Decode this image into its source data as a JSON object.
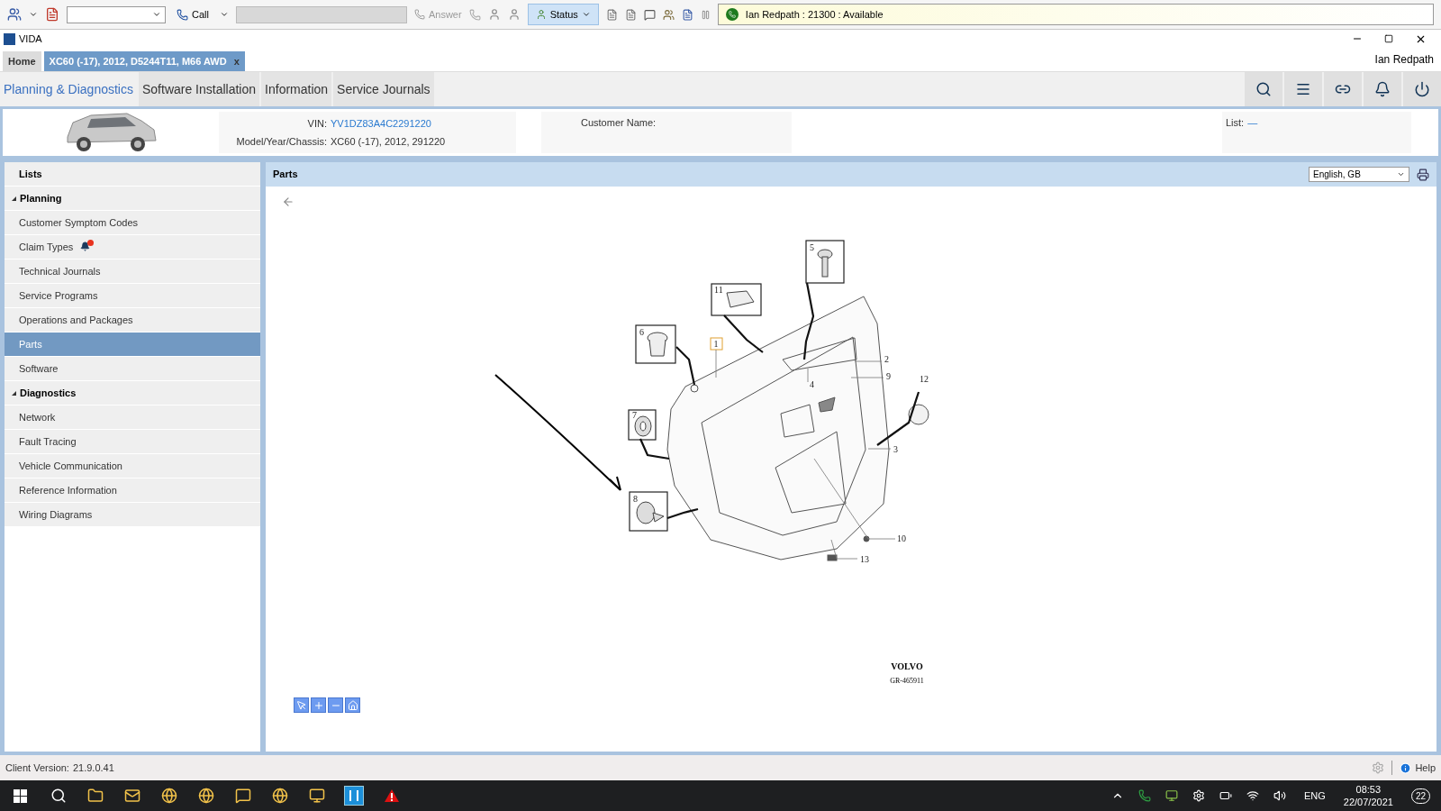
{
  "toolbar": {
    "call": "Call",
    "answer": "Answer",
    "status": "Status",
    "presence": "Ian Redpath : 21300 : Available"
  },
  "window": {
    "title": "VIDA",
    "user": "Ian Redpath"
  },
  "tabs": [
    {
      "label": "Home",
      "selected": false
    },
    {
      "label": "XC60 (-17), 2012, D5244T11, M66 AWD",
      "selected": true,
      "close": "x"
    }
  ],
  "nav": [
    {
      "label": "Planning & Diagnostics",
      "selected": true
    },
    {
      "label": "Software Installation",
      "selected": false
    },
    {
      "label": "Information",
      "selected": false
    },
    {
      "label": "Service Journals",
      "selected": false
    }
  ],
  "vehicle": {
    "vin_label": "VIN:",
    "vin": "YV1DZ83A4C2291220",
    "model_label": "Model/Year/Chassis:",
    "model": "XC60 (-17), 2012, 291220",
    "customer_label": "Customer Name:",
    "list_label": "List:",
    "list_value": "—"
  },
  "sidebar": {
    "items": [
      {
        "kind": "header",
        "label": "Lists"
      },
      {
        "kind": "group",
        "label": "Planning",
        "expanded": true,
        "children": [
          {
            "label": "Customer Symptom Codes",
            "selected": false,
            "alert": false
          },
          {
            "label": "Claim Types",
            "selected": false,
            "alert": true
          },
          {
            "label": "Technical Journals",
            "selected": false,
            "alert": false
          },
          {
            "label": "Service Programs",
            "selected": false,
            "alert": false
          },
          {
            "label": "Operations and Packages",
            "selected": false,
            "alert": false
          },
          {
            "label": "Parts",
            "selected": true,
            "alert": false
          },
          {
            "label": "Software",
            "selected": false,
            "alert": false
          }
        ]
      },
      {
        "kind": "group",
        "label": "Diagnostics",
        "expanded": true,
        "children": [
          {
            "label": "Network",
            "selected": false,
            "alert": false
          },
          {
            "label": "Fault Tracing",
            "selected": false,
            "alert": false
          },
          {
            "label": "Vehicle Communication",
            "selected": false,
            "alert": false
          },
          {
            "label": "Reference Information",
            "selected": false,
            "alert": false
          },
          {
            "label": "Wiring Diagrams",
            "selected": false,
            "alert": false
          }
        ]
      }
    ]
  },
  "panel": {
    "title": "Parts",
    "language": "English, GB",
    "diagram": {
      "callouts": [
        "1",
        "2",
        "3",
        "4",
        "5",
        "6",
        "7",
        "8",
        "9",
        "10",
        "11",
        "12",
        "13"
      ],
      "logo": "VOLVO",
      "reference": "GR-465911"
    }
  },
  "status_bar": {
    "version_label": "Client Version:",
    "version": "21.9.0.41",
    "help": "Help"
  },
  "taskbar": {
    "language": "ENG",
    "time": "08:53",
    "date": "22/07/2021",
    "notifications": "22"
  }
}
